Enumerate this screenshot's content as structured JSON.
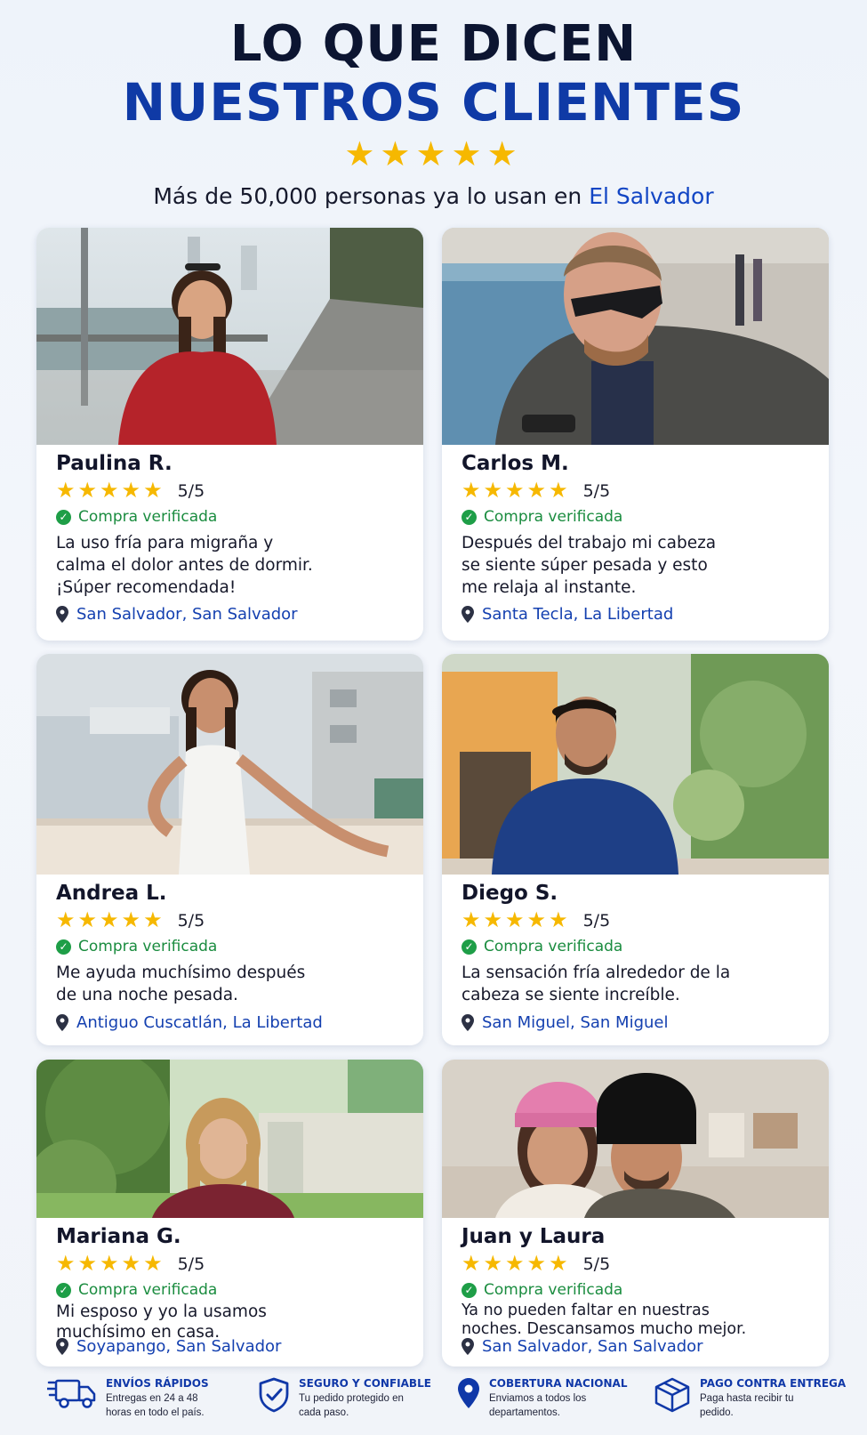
{
  "header": {
    "title_line1": "LO QUE DICEN",
    "title_line2": "NUESTROS CLIENTES",
    "stars": "★★★★★",
    "subtitle_prefix": "Más de 50,000 personas ya lo usan en ",
    "subtitle_highlight": "El Salvador"
  },
  "common": {
    "stars": "★★★★★",
    "score": "5/5",
    "verified": "Compra verificada"
  },
  "reviews": [
    {
      "name": "Paulina R.",
      "quote": "La uso fría para migraña y calma el dolor antes de dormir. ¡Súper recomendada!",
      "location": "San Salvador, San Salvador"
    },
    {
      "name": "Carlos M.",
      "quote": "Después del trabajo mi cabeza se siente súper pesada y esto me relaja al instante.",
      "location": "Santa Tecla, La Libertad"
    },
    {
      "name": "Andrea L.",
      "quote": "Me ayuda muchísimo después de una noche pesada.",
      "location": "Antiguo Cuscatlán, La Libertad"
    },
    {
      "name": "Diego S.",
      "quote": "La sensación fría alrededor de la cabeza se siente increíble.",
      "location": "San Miguel, San Miguel"
    },
    {
      "name": "Mariana G.",
      "quote": "Mi esposo y yo la usamos muchísimo en casa.",
      "location": "Soyapango, San Salvador"
    },
    {
      "name": "Juan y Laura",
      "quote": "Ya no pueden faltar en nuestras noches. Descansamos mucho mejor.",
      "location": "San Salvador, San Salvador"
    }
  ],
  "features": [
    {
      "icon": "truck-icon",
      "title": "ENVÍOS RÁPIDOS",
      "text": "Entregas en 24 a 48 horas en todo el país."
    },
    {
      "icon": "shield-icon",
      "title": "SEGURO Y CONFIABLE",
      "text": "Tu pedido protegido en cada paso."
    },
    {
      "icon": "location-pin-icon",
      "title": "COBERTURA NACIONAL",
      "text": "Enviamos a todos los departamentos."
    },
    {
      "icon": "package-icon",
      "title": "PAGO CONTRA ENTREGA",
      "text": "Paga hasta recibir tu pedido."
    }
  ],
  "colors": {
    "navy": "#0c1531",
    "blue": "#0f3aa6",
    "star": "#f6b800",
    "verified_green": "#1a8c3f",
    "location_blue": "#1440b0"
  }
}
